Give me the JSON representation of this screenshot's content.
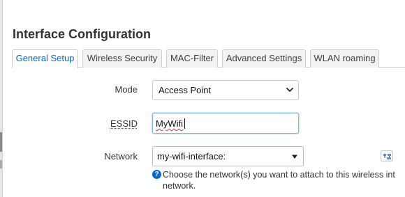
{
  "page": {
    "title": "Interface Configuration"
  },
  "tabs": [
    {
      "label": "General Setup",
      "active": true
    },
    {
      "label": "Wireless Security",
      "active": false
    },
    {
      "label": "MAC-Filter",
      "active": false
    },
    {
      "label": "Advanced Settings",
      "active": false
    },
    {
      "label": "WLAN roaming",
      "active": false
    }
  ],
  "form": {
    "mode": {
      "label": "Mode",
      "value": "Access Point"
    },
    "essid": {
      "label": "ESSID",
      "value": "MyWifi"
    },
    "network": {
      "label": "Network",
      "value": "my-wifi-interface:",
      "icon": "wireless-network-icon",
      "help_line1": "Choose the network(s) you want to attach to this wireless int",
      "help_line2": "network."
    }
  },
  "colors": {
    "accent": "#0069d6",
    "tab_border": "#cccccc",
    "input_focus_border": "#7fb4e6"
  }
}
